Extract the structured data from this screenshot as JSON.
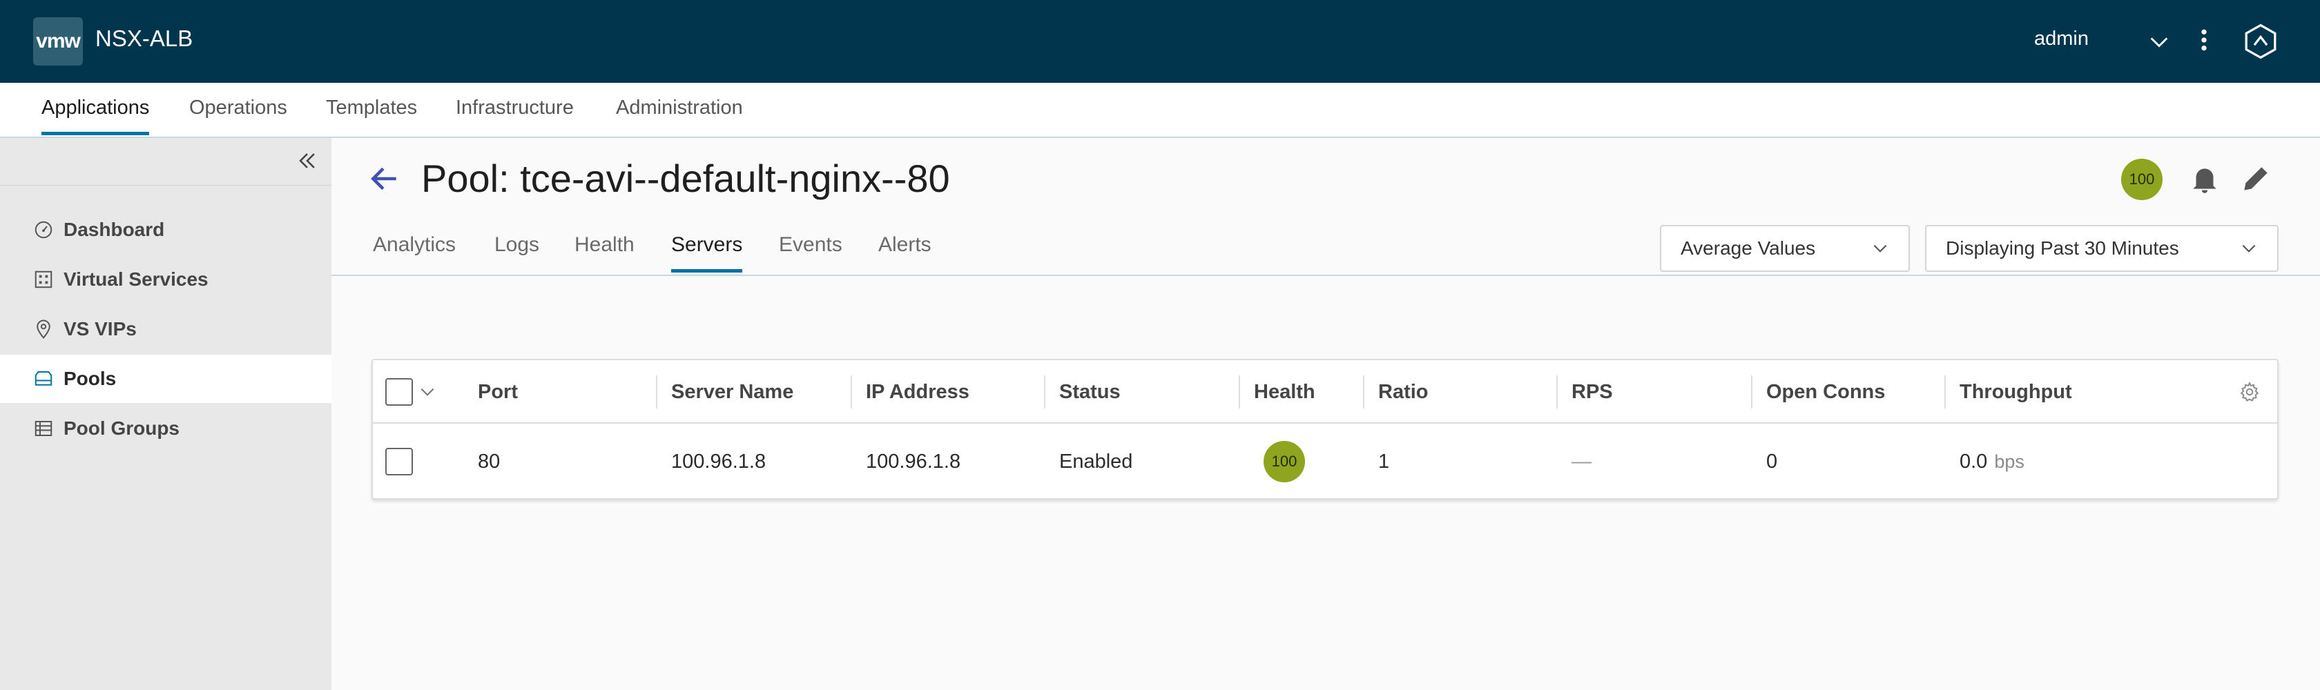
{
  "header": {
    "logo_text": "vmw",
    "brand": "NSX-ALB",
    "user": "admin",
    "colors": {
      "header_bg": "#00364d",
      "accent": "#0072a3",
      "health_green": "#8fa51f"
    }
  },
  "topnav": {
    "items": [
      "Applications",
      "Operations",
      "Templates",
      "Infrastructure",
      "Administration"
    ],
    "active": "Applications"
  },
  "sidebar": {
    "items": [
      {
        "label": "Dashboard",
        "icon": "gauge-icon"
      },
      {
        "label": "Virtual Services",
        "icon": "grid-icon"
      },
      {
        "label": "VS VIPs",
        "icon": "map-pin-icon"
      },
      {
        "label": "Pools",
        "icon": "pool-icon"
      },
      {
        "label": "Pool Groups",
        "icon": "list-icon"
      }
    ],
    "active": "Pools"
  },
  "page": {
    "title": "Pool: tce-avi--default-nginx--80",
    "health_score": "100"
  },
  "tabs": {
    "items": [
      "Analytics",
      "Logs",
      "Health",
      "Servers",
      "Events",
      "Alerts"
    ],
    "active": "Servers"
  },
  "controls": {
    "values_select": "Average Values",
    "time_select": "Displaying Past 30 Minutes"
  },
  "table": {
    "columns": [
      "Port",
      "Server Name",
      "IP Address",
      "Status",
      "Health",
      "Ratio",
      "RPS",
      "Open Conns",
      "Throughput"
    ],
    "rows": [
      {
        "port": "80",
        "server_name": "100.96.1.8",
        "ip_address": "100.96.1.8",
        "status": "Enabled",
        "health": "100",
        "ratio": "1",
        "rps": "—",
        "open_conns": "0",
        "throughput_value": "0.0",
        "throughput_unit": "bps"
      }
    ]
  }
}
